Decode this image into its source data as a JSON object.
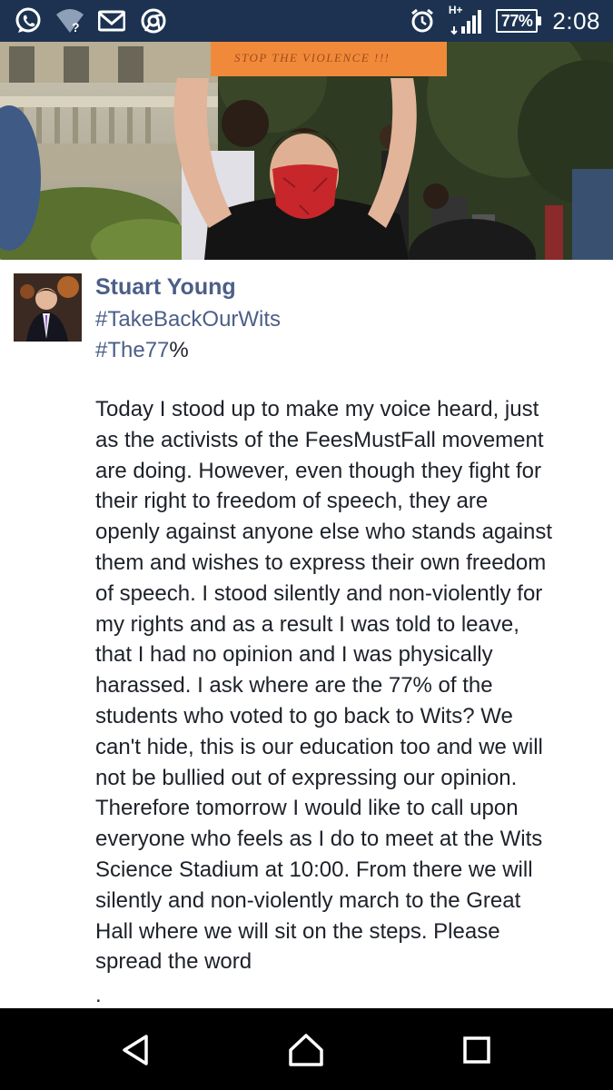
{
  "status_bar": {
    "left_icons": [
      "whatsapp-icon",
      "wifi-unknown-icon",
      "gmail-icon",
      "chrome-icon"
    ],
    "network_label": "H+",
    "battery": "77%",
    "time": "2:08"
  },
  "photo": {
    "sign_text": "STOP THE VIOLENCE !!!"
  },
  "post": {
    "author": "Stuart Young",
    "hashtag_1": "#TakeBackOurWits",
    "hashtag_2": "#The77",
    "hashtag_2_suffix": "%",
    "body": "Today I stood up to make my voice heard, just\nas the activists of the FeesMustFall movement\nare doing. However, even though they fight for\ntheir right to freedom of speech, they are\nopenly against anyone else who stands against\nthem and wishes to express their own freedom\nof speech. I stood silently and non-violently for\nmy rights and as a result I was told to leave,\nthat I had no opinion and I was physically\nharassed. I ask where are the 77% of the\nstudents who voted to go back to Wits? We\ncan't hide, this is our education too and we will\nnot be bullied out of expressing our opinion.\nTherefore tomorrow I would like to call upon\neveryone who feels as I do to meet at the Wits\nScience Stadium at 10:00. From there we will\nsilently and non-violently march to the Great\nHall where we will sit on the steps. Please\nspread the word",
    "trailing": "."
  },
  "nav_bar": {
    "buttons": [
      "back-icon",
      "home-icon",
      "recents-icon"
    ]
  },
  "colors": {
    "status_bar_bg": "#1c3250",
    "author_link": "#4b5f87",
    "body_text": "#1d2129",
    "nav_bar_bg": "#000000"
  }
}
